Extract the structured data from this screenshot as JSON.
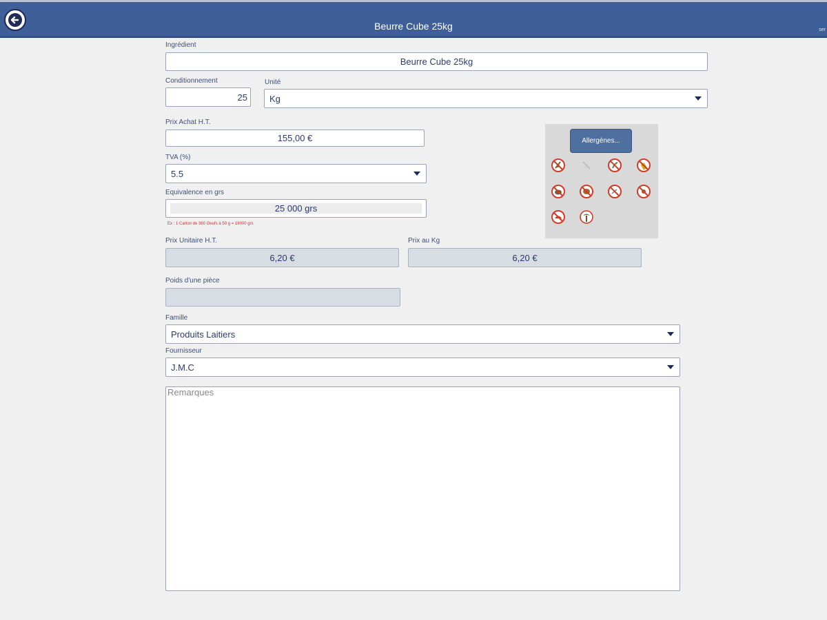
{
  "header": {
    "title": "Beurre Cube 25kg",
    "corner_text": "ser",
    "back_icon": "arrow-left-icon"
  },
  "form": {
    "ingredient": {
      "label": "Ingrédient",
      "value": "Beurre Cube 25kg"
    },
    "conditionnement": {
      "label": "Conditionnement",
      "value": "25"
    },
    "unite": {
      "label": "Unité",
      "value": "Kg"
    },
    "prix_achat": {
      "label": "Prix Achat H.T.",
      "value": "155,00 €"
    },
    "tva": {
      "label": "TVA (%)",
      "value": "5.5"
    },
    "equivalence": {
      "label": "Equivalence en grs",
      "value": "25 000 grs",
      "hint": "Ex : 1 Carton de 360 Oeufs à 50 g = 18000 grs"
    },
    "prix_unitaire": {
      "label": "Prix Unitaire H.T.",
      "value": "6,20 €"
    },
    "prix_kg": {
      "label": "Prix au Kg",
      "value": "6,20 €"
    },
    "poids_piece": {
      "label": "Poids d'une pièce",
      "value": ""
    },
    "famille": {
      "label": "Famille",
      "value": "Produits Laitiers"
    },
    "fournisseur": {
      "label": "Fournisseur",
      "value": "J.M.C"
    },
    "remarques": {
      "legend": "Remarques",
      "value": ""
    }
  },
  "allergens": {
    "button_label": "Allergènes...",
    "icons": [
      "no-gluten-icon",
      "no-lupin-icon",
      "no-sesame-icon",
      "no-mustard-icon",
      "no-crustacean-icon",
      "no-nuts-icon",
      "no-fish-icon",
      "no-egg-icon",
      "no-mollusc-icon",
      "no-celery-icon"
    ]
  },
  "colors": {
    "header_bg": "#3f5f98",
    "accent_text": "#2b3a6e",
    "hint_red": "#d03030",
    "allergen_button": "#4f6f9f"
  }
}
